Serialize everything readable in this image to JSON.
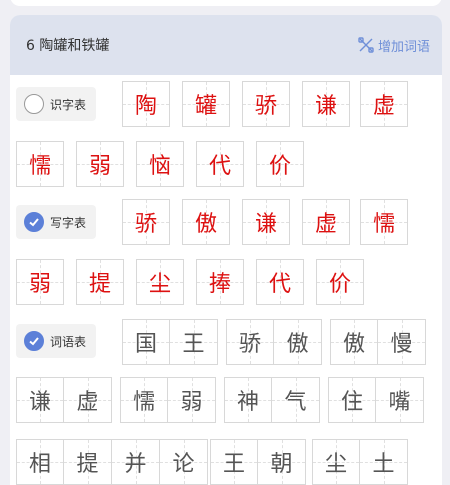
{
  "lesson": {
    "title": "6 陶罐和铁罐",
    "add_label": "增加词语",
    "colors": {
      "accent": "#6f8fd8",
      "header_bg": "#dde2ee",
      "char_red": "#dd1111",
      "char_gray": "#555555"
    }
  },
  "shizi": {
    "label": "识字表",
    "checked": false,
    "chars": [
      "陶",
      "罐",
      "骄",
      "谦",
      "虚",
      "懦",
      "弱",
      "恼",
      "代",
      "价"
    ]
  },
  "xiezi": {
    "label": "写字表",
    "checked": true,
    "chars": [
      "骄",
      "傲",
      "谦",
      "虚",
      "懦",
      "弱",
      "提",
      "尘",
      "捧",
      "代",
      "价"
    ]
  },
  "ciyu": {
    "label": "词语表",
    "checked": true,
    "words": [
      "国王",
      "骄傲",
      "傲慢",
      "谦虚",
      "懦弱",
      "神气",
      "住嘴",
      "相提并论",
      "王朝",
      "尘土"
    ]
  }
}
